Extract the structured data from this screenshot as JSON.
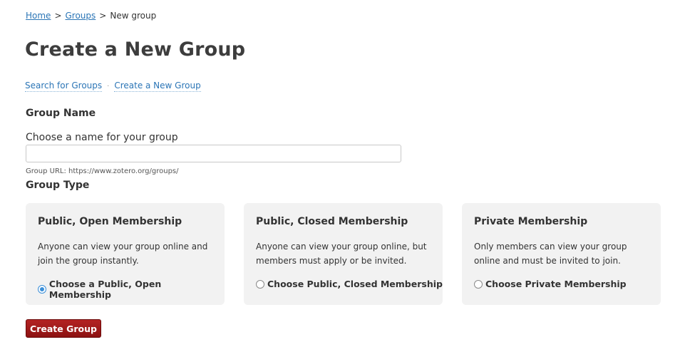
{
  "breadcrumb": {
    "home": "Home",
    "groups": "Groups",
    "current": "New group",
    "separator": ">"
  },
  "page_title": "Create a New Group",
  "subnav": {
    "search": "Search for Groups",
    "separator": "·",
    "create": "Create a New Group"
  },
  "form": {
    "group_name_heading": "Group Name",
    "name_label": "Choose a name for your group",
    "name_value": "",
    "group_url_help": "Group URL: https://www.zotero.org/groups/",
    "group_type_heading": "Group Type"
  },
  "group_types": [
    {
      "title": "Public, Open Membership",
      "description": "Anyone can view your group online and join the group instantly.",
      "choice_label": "Choose a Public, Open Membership",
      "selected": true
    },
    {
      "title": "Public, Closed Membership",
      "description": "Anyone can view your group online, but members must apply or be invited.",
      "choice_label": "Choose Public, Closed Membership",
      "selected": false
    },
    {
      "title": "Private Membership",
      "description": "Only members can view your group online and must be invited to join.",
      "choice_label": "Choose Private Membership",
      "selected": false
    }
  ],
  "submit_label": "Create Group",
  "colors": {
    "link": "#2b75b6",
    "card_bg": "#f2f2f2",
    "button": "#a01b1b",
    "radio_selected": "#3b8fd9"
  }
}
